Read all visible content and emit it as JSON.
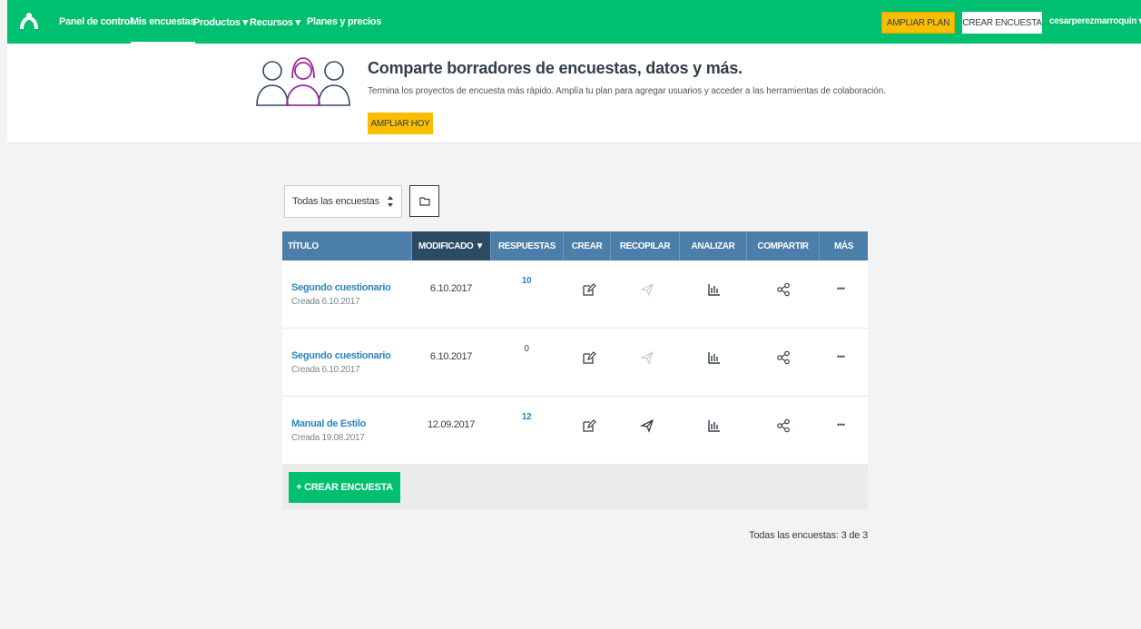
{
  "nav": {
    "items": [
      "Panel de control",
      "Mis encuestas",
      "Productos ▾",
      "Recursos ▾",
      "Planes y precios"
    ],
    "upgrade_label": "AMPLIAR PLAN",
    "create_label": "CREAR ENCUESTA",
    "user": "cesarperezmarroquin ▾"
  },
  "promo": {
    "title": "Comparte borradores de encuestas, datos y más.",
    "subtitle": "Termina los proyectos de encuesta más rápido. Amplía tu plan para agregar usuarios y acceder a las herramientas de colaboración.",
    "button": "AMPLIAR HOY"
  },
  "filter": {
    "selected": "Todas las encuestas"
  },
  "table": {
    "headers": [
      "TÍTULO",
      "MODIFICADO ▼",
      "RESPUESTAS",
      "CREAR",
      "RECOPILAR",
      "ANALIZAR",
      "COMPARTIR",
      "MÁS"
    ],
    "rows": [
      {
        "title": "Segundo cuestionario",
        "created": "Creada 6.10.2017",
        "modified": "6.10.2017",
        "responses": "10"
      },
      {
        "title": "Segundo cuestionario",
        "created": "Creada 6.10.2017",
        "modified": "6.10.2017",
        "responses": "0"
      },
      {
        "title": "Manual de Estilo",
        "created": "Creada 19.08.2017",
        "modified": "12.09.2017",
        "responses": "12"
      }
    ],
    "more_glyph": "•••"
  },
  "create_button": "+ CREAR ENCUESTA",
  "count_text": "Todas las encuestas: 3 de 3",
  "colors": {
    "brand_green": "#00bf6f",
    "header_blue": "#4b7ea8",
    "sorted_header": "#2d4a63",
    "upgrade_yellow": "#f9be00",
    "link_blue": "#2b85c0"
  }
}
